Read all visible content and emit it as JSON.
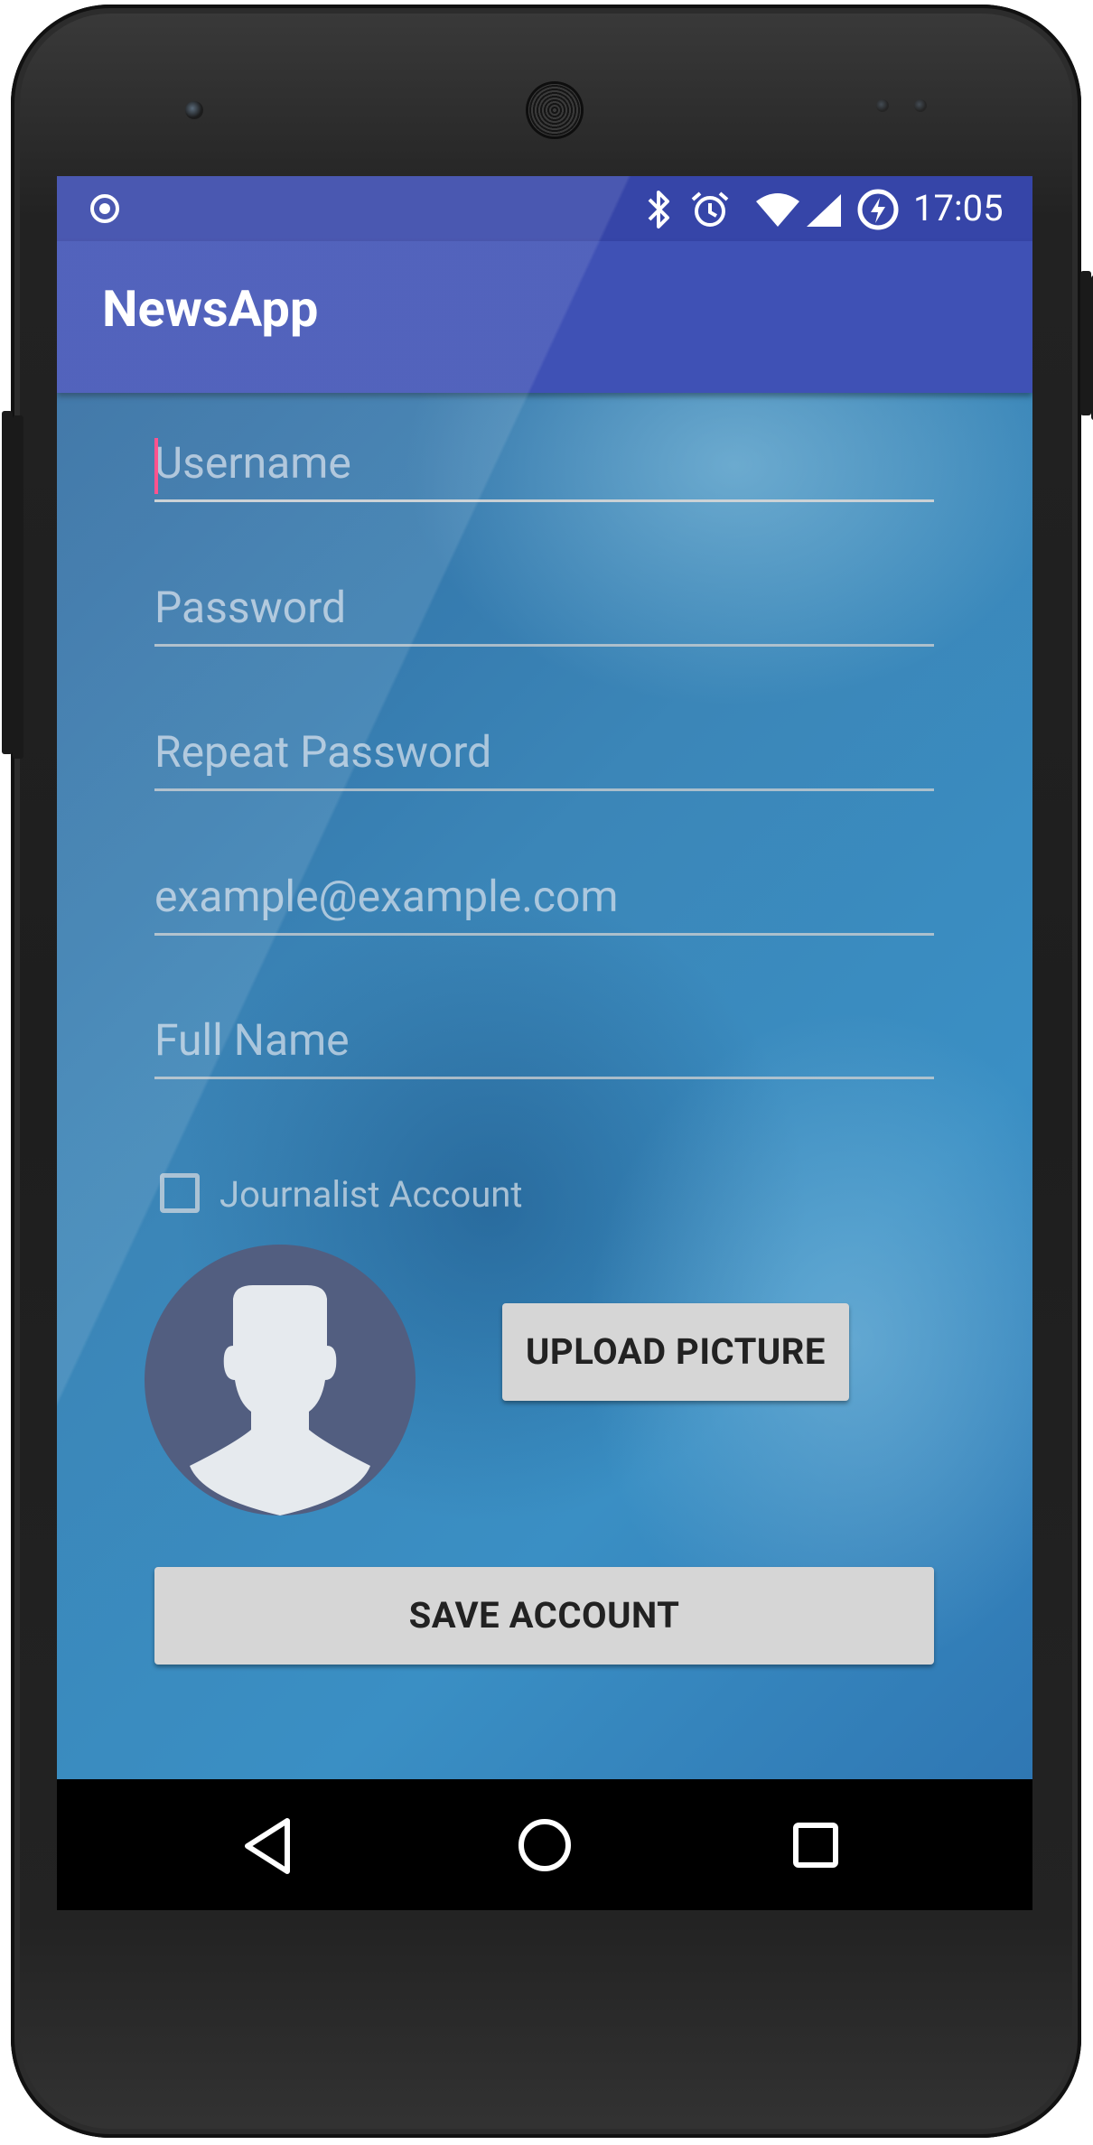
{
  "status_bar": {
    "time": "17:05",
    "icons": [
      "record-icon",
      "bluetooth-icon",
      "alarm-icon",
      "wifi-icon",
      "signal-icon",
      "battery-charging-icon"
    ]
  },
  "app_bar": {
    "title": "NewsApp"
  },
  "form": {
    "username_placeholder": "Username",
    "password_placeholder": "Password",
    "repeat_password_placeholder": "Repeat Password",
    "email_placeholder": "example@example.com",
    "full_name_placeholder": "Full Name",
    "journalist_label": "Journalist Account",
    "journalist_checked": false,
    "upload_label": "UPLOAD PICTURE",
    "save_label": "SAVE ACCOUNT"
  },
  "nav_bar": {
    "icons": [
      "back-icon",
      "home-icon",
      "recents-icon"
    ]
  },
  "colors": {
    "status_bar": "#3645a8",
    "app_bar": "#3f51b5",
    "accent": "#ff4081",
    "button": "#d6d6d6",
    "avatar_bg": "#525e80"
  }
}
